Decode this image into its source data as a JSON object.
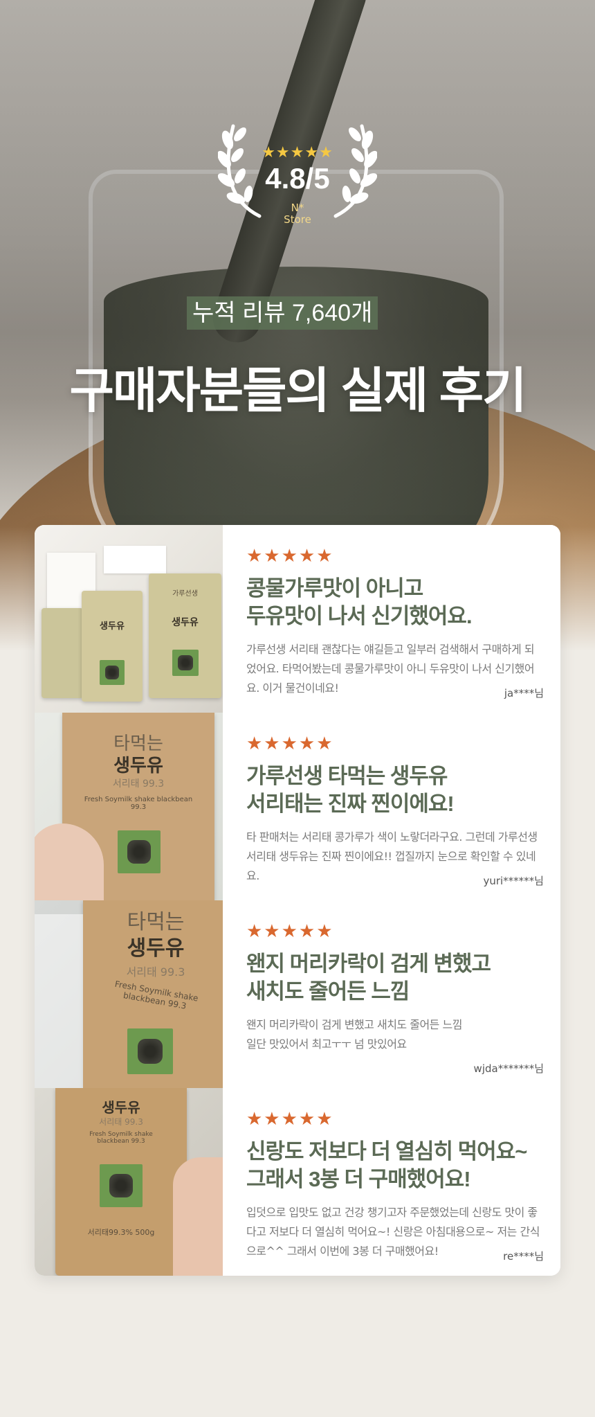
{
  "hero": {
    "badge": {
      "stars": "★★★★★",
      "score": "4.8/5",
      "store_line1": "N*",
      "store_line2": "Store"
    },
    "review_count": "누적 리뷰  7,640개",
    "title": "구매자분들의 실제 후기"
  },
  "colors": {
    "accent_green": "#5b6a55",
    "star_orange": "#d9682f",
    "badge_star": "#f5c842",
    "pill_green": "#5d7256"
  },
  "photo_text": {
    "pack_brand": "가루선생",
    "pack_title_a": "타먹는",
    "pack_title_b": "생두유",
    "pack_sub": "서리태 99.3",
    "pack_en": "Fresh Soymilk shake blackbean 99.3",
    "pack_weight": "서리태99.3% 500g"
  },
  "reviews": [
    {
      "stars": "★★★★★",
      "title": "콩물가루맛이 아니고\n두유맛이 나서 신기했어요.",
      "text": "가루선생 서리태 괜찮다는 얘길듣고 일부러 검색해서 구매하게 되었어요. 타먹어봤는데 콩물가루맛이 아니 두유맛이 나서 신기했어요. 이거 물건이네요!",
      "user": "ja****님"
    },
    {
      "stars": "★★★★★",
      "title": "가루선생 타먹는 생두유\n서리태는 진짜 찐이에요!",
      "text": "타 판매처는 서리태 콩가루가 색이 노랗더라구요. 그런데 가루선생 서리태 생두유는 진짜 찐이에요!! 껍질까지 눈으로 확인할 수 있네요.",
      "user": "yuri******님"
    },
    {
      "stars": "★★★★★",
      "title": "왠지 머리카락이 검게 변했고\n새치도 줄어든 느낌",
      "text": "왠지 머리카락이 검게 변했고 새치도 줄어든 느낌\n일단 맛있어서 최고ㅜㅜ 넘 맛있어요",
      "user": "wjda*******님"
    },
    {
      "stars": "★★★★★",
      "title": "신랑도 저보다 더 열심히 먹어요~\n그래서 3봉 더 구매했어요!",
      "text": "입덧으로 입맛도 없고 건강 챙기고자 주문했었는데 신랑도 맛이 좋다고 저보다 더 열심히 먹어요~! 신랑은 아침대용으로~ 저는 간식으로^^ 그래서 이번에 3봉 더 구매했어요!",
      "user": "re****님"
    }
  ]
}
